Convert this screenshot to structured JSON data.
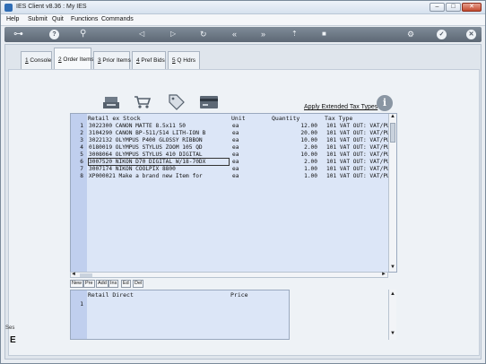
{
  "window": {
    "title": "IES Client v8.36 : My IES",
    "min_label": "–",
    "max_label": "□",
    "close_label": "✕"
  },
  "menu": [
    "Help",
    "Submit",
    "Quit",
    "Functions",
    "Commands"
  ],
  "toolbar": {
    "icons": [
      "key-icon",
      "help-icon",
      "search-icon",
      "back-icon",
      "forward-icon",
      "refresh-icon",
      "first-icon",
      "next-icon",
      "up-icon",
      "stop-icon",
      "settings-icon",
      "confirm-icon",
      "close-icon"
    ],
    "help_glyph": "?",
    "confirm_glyph": "✓",
    "close_glyph": "✕"
  },
  "tabs": [
    {
      "key": "1",
      "label": " Console"
    },
    {
      "key": "2",
      "label": " Order Items"
    },
    {
      "key": "3",
      "label": " Prior Items"
    },
    {
      "key": "4",
      "label": " Pref Bids"
    },
    {
      "key": "5",
      "label": " Q Hdrs"
    }
  ],
  "actions": {
    "icons": [
      "register-icon",
      "cart-icon",
      "price-tag-icon",
      "card-icon"
    ],
    "apply_tax": "Apply Extended Tax Types",
    "info_glyph": "i"
  },
  "grid": {
    "headers": {
      "stock": "Retail ex Stock",
      "unit": "Unit",
      "qty": "Quantity",
      "tax": "Tax Type"
    },
    "rows": [
      {
        "n": "1",
        "stock": "3022300 CANON MATTE 8.5x11 50",
        "unit": "ea",
        "qty": "12.00",
        "tax": "101 VAT OUT: VAT/PU"
      },
      {
        "n": "2",
        "stock": "3104290 CANON BP-511/514 LITH-ION B",
        "unit": "ea",
        "qty": "20.00",
        "tax": "101 VAT OUT: VAT/PU"
      },
      {
        "n": "3",
        "stock": "3022132 OLYMPUS P400 GLOSSY RIBBON",
        "unit": "ea",
        "qty": "10.00",
        "tax": "101 VAT OUT: VAT/PU"
      },
      {
        "n": "4",
        "stock": "0180019 OLYMPUS STYLUS ZOOM 105 QD",
        "unit": "ea",
        "qty": "2.00",
        "tax": "101 VAT OUT: VAT/PU"
      },
      {
        "n": "5",
        "stock": "3008064 OLYMPUS STYLUS 410 DIGITAL",
        "unit": "ea",
        "qty": "10.00",
        "tax": "101 VAT OUT: VAT/PU"
      },
      {
        "n": "6",
        "stock": "3007520 NIKON D70 DIGITAL W/18-70DX",
        "unit": "ea",
        "qty": "2.00",
        "tax": "101 VAT OUT: VAT/PU"
      },
      {
        "n": "7",
        "stock": "3007174 NIKON COOLPIX 8800",
        "unit": "ea",
        "qty": "1.00",
        "tax": "101 VAT OUT: VAT/PU"
      },
      {
        "n": "8",
        "stock": "XP000021 Make a brand new Item for",
        "unit": "ea",
        "qty": "1.00",
        "tax": "101 VAT OUT: VAT/PU"
      }
    ],
    "up_arrow": "▲",
    "down_arrow": "▼",
    "left_arrow": "◄",
    "right_arrow": "►"
  },
  "row_buttons": [
    "New",
    "Pre",
    "Add",
    "Ins",
    "Ed",
    "Del"
  ],
  "grid2": {
    "headers": {
      "desc": "Retail Direct",
      "price": "Price"
    },
    "rows": [
      {
        "n": "1"
      }
    ]
  },
  "side": {
    "label": "Ses",
    "big": "E"
  }
}
